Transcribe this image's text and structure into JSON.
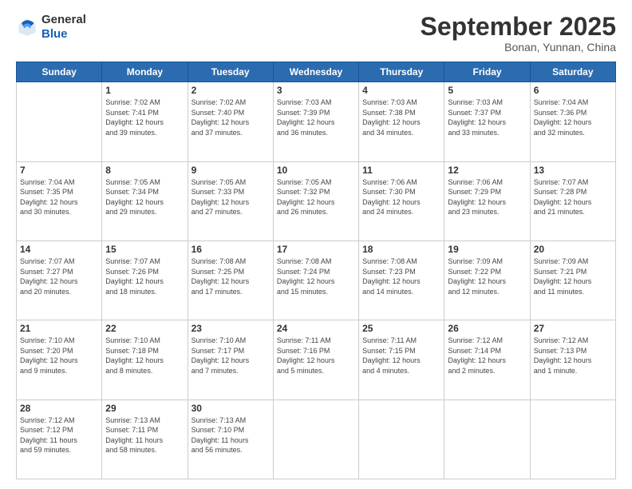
{
  "logo": {
    "line1": "General",
    "line2": "Blue"
  },
  "title": "September 2025",
  "location": "Bonan, Yunnan, China",
  "weekdays": [
    "Sunday",
    "Monday",
    "Tuesday",
    "Wednesday",
    "Thursday",
    "Friday",
    "Saturday"
  ],
  "weeks": [
    [
      {
        "day": "",
        "info": ""
      },
      {
        "day": "1",
        "info": "Sunrise: 7:02 AM\nSunset: 7:41 PM\nDaylight: 12 hours\nand 39 minutes."
      },
      {
        "day": "2",
        "info": "Sunrise: 7:02 AM\nSunset: 7:40 PM\nDaylight: 12 hours\nand 37 minutes."
      },
      {
        "day": "3",
        "info": "Sunrise: 7:03 AM\nSunset: 7:39 PM\nDaylight: 12 hours\nand 36 minutes."
      },
      {
        "day": "4",
        "info": "Sunrise: 7:03 AM\nSunset: 7:38 PM\nDaylight: 12 hours\nand 34 minutes."
      },
      {
        "day": "5",
        "info": "Sunrise: 7:03 AM\nSunset: 7:37 PM\nDaylight: 12 hours\nand 33 minutes."
      },
      {
        "day": "6",
        "info": "Sunrise: 7:04 AM\nSunset: 7:36 PM\nDaylight: 12 hours\nand 32 minutes."
      }
    ],
    [
      {
        "day": "7",
        "info": "Sunrise: 7:04 AM\nSunset: 7:35 PM\nDaylight: 12 hours\nand 30 minutes."
      },
      {
        "day": "8",
        "info": "Sunrise: 7:05 AM\nSunset: 7:34 PM\nDaylight: 12 hours\nand 29 minutes."
      },
      {
        "day": "9",
        "info": "Sunrise: 7:05 AM\nSunset: 7:33 PM\nDaylight: 12 hours\nand 27 minutes."
      },
      {
        "day": "10",
        "info": "Sunrise: 7:05 AM\nSunset: 7:32 PM\nDaylight: 12 hours\nand 26 minutes."
      },
      {
        "day": "11",
        "info": "Sunrise: 7:06 AM\nSunset: 7:30 PM\nDaylight: 12 hours\nand 24 minutes."
      },
      {
        "day": "12",
        "info": "Sunrise: 7:06 AM\nSunset: 7:29 PM\nDaylight: 12 hours\nand 23 minutes."
      },
      {
        "day": "13",
        "info": "Sunrise: 7:07 AM\nSunset: 7:28 PM\nDaylight: 12 hours\nand 21 minutes."
      }
    ],
    [
      {
        "day": "14",
        "info": "Sunrise: 7:07 AM\nSunset: 7:27 PM\nDaylight: 12 hours\nand 20 minutes."
      },
      {
        "day": "15",
        "info": "Sunrise: 7:07 AM\nSunset: 7:26 PM\nDaylight: 12 hours\nand 18 minutes."
      },
      {
        "day": "16",
        "info": "Sunrise: 7:08 AM\nSunset: 7:25 PM\nDaylight: 12 hours\nand 17 minutes."
      },
      {
        "day": "17",
        "info": "Sunrise: 7:08 AM\nSunset: 7:24 PM\nDaylight: 12 hours\nand 15 minutes."
      },
      {
        "day": "18",
        "info": "Sunrise: 7:08 AM\nSunset: 7:23 PM\nDaylight: 12 hours\nand 14 minutes."
      },
      {
        "day": "19",
        "info": "Sunrise: 7:09 AM\nSunset: 7:22 PM\nDaylight: 12 hours\nand 12 minutes."
      },
      {
        "day": "20",
        "info": "Sunrise: 7:09 AM\nSunset: 7:21 PM\nDaylight: 12 hours\nand 11 minutes."
      }
    ],
    [
      {
        "day": "21",
        "info": "Sunrise: 7:10 AM\nSunset: 7:20 PM\nDaylight: 12 hours\nand 9 minutes."
      },
      {
        "day": "22",
        "info": "Sunrise: 7:10 AM\nSunset: 7:18 PM\nDaylight: 12 hours\nand 8 minutes."
      },
      {
        "day": "23",
        "info": "Sunrise: 7:10 AM\nSunset: 7:17 PM\nDaylight: 12 hours\nand 7 minutes."
      },
      {
        "day": "24",
        "info": "Sunrise: 7:11 AM\nSunset: 7:16 PM\nDaylight: 12 hours\nand 5 minutes."
      },
      {
        "day": "25",
        "info": "Sunrise: 7:11 AM\nSunset: 7:15 PM\nDaylight: 12 hours\nand 4 minutes."
      },
      {
        "day": "26",
        "info": "Sunrise: 7:12 AM\nSunset: 7:14 PM\nDaylight: 12 hours\nand 2 minutes."
      },
      {
        "day": "27",
        "info": "Sunrise: 7:12 AM\nSunset: 7:13 PM\nDaylight: 12 hours\nand 1 minute."
      }
    ],
    [
      {
        "day": "28",
        "info": "Sunrise: 7:12 AM\nSunset: 7:12 PM\nDaylight: 11 hours\nand 59 minutes."
      },
      {
        "day": "29",
        "info": "Sunrise: 7:13 AM\nSunset: 7:11 PM\nDaylight: 11 hours\nand 58 minutes."
      },
      {
        "day": "30",
        "info": "Sunrise: 7:13 AM\nSunset: 7:10 PM\nDaylight: 11 hours\nand 56 minutes."
      },
      {
        "day": "",
        "info": ""
      },
      {
        "day": "",
        "info": ""
      },
      {
        "day": "",
        "info": ""
      },
      {
        "day": "",
        "info": ""
      }
    ]
  ]
}
